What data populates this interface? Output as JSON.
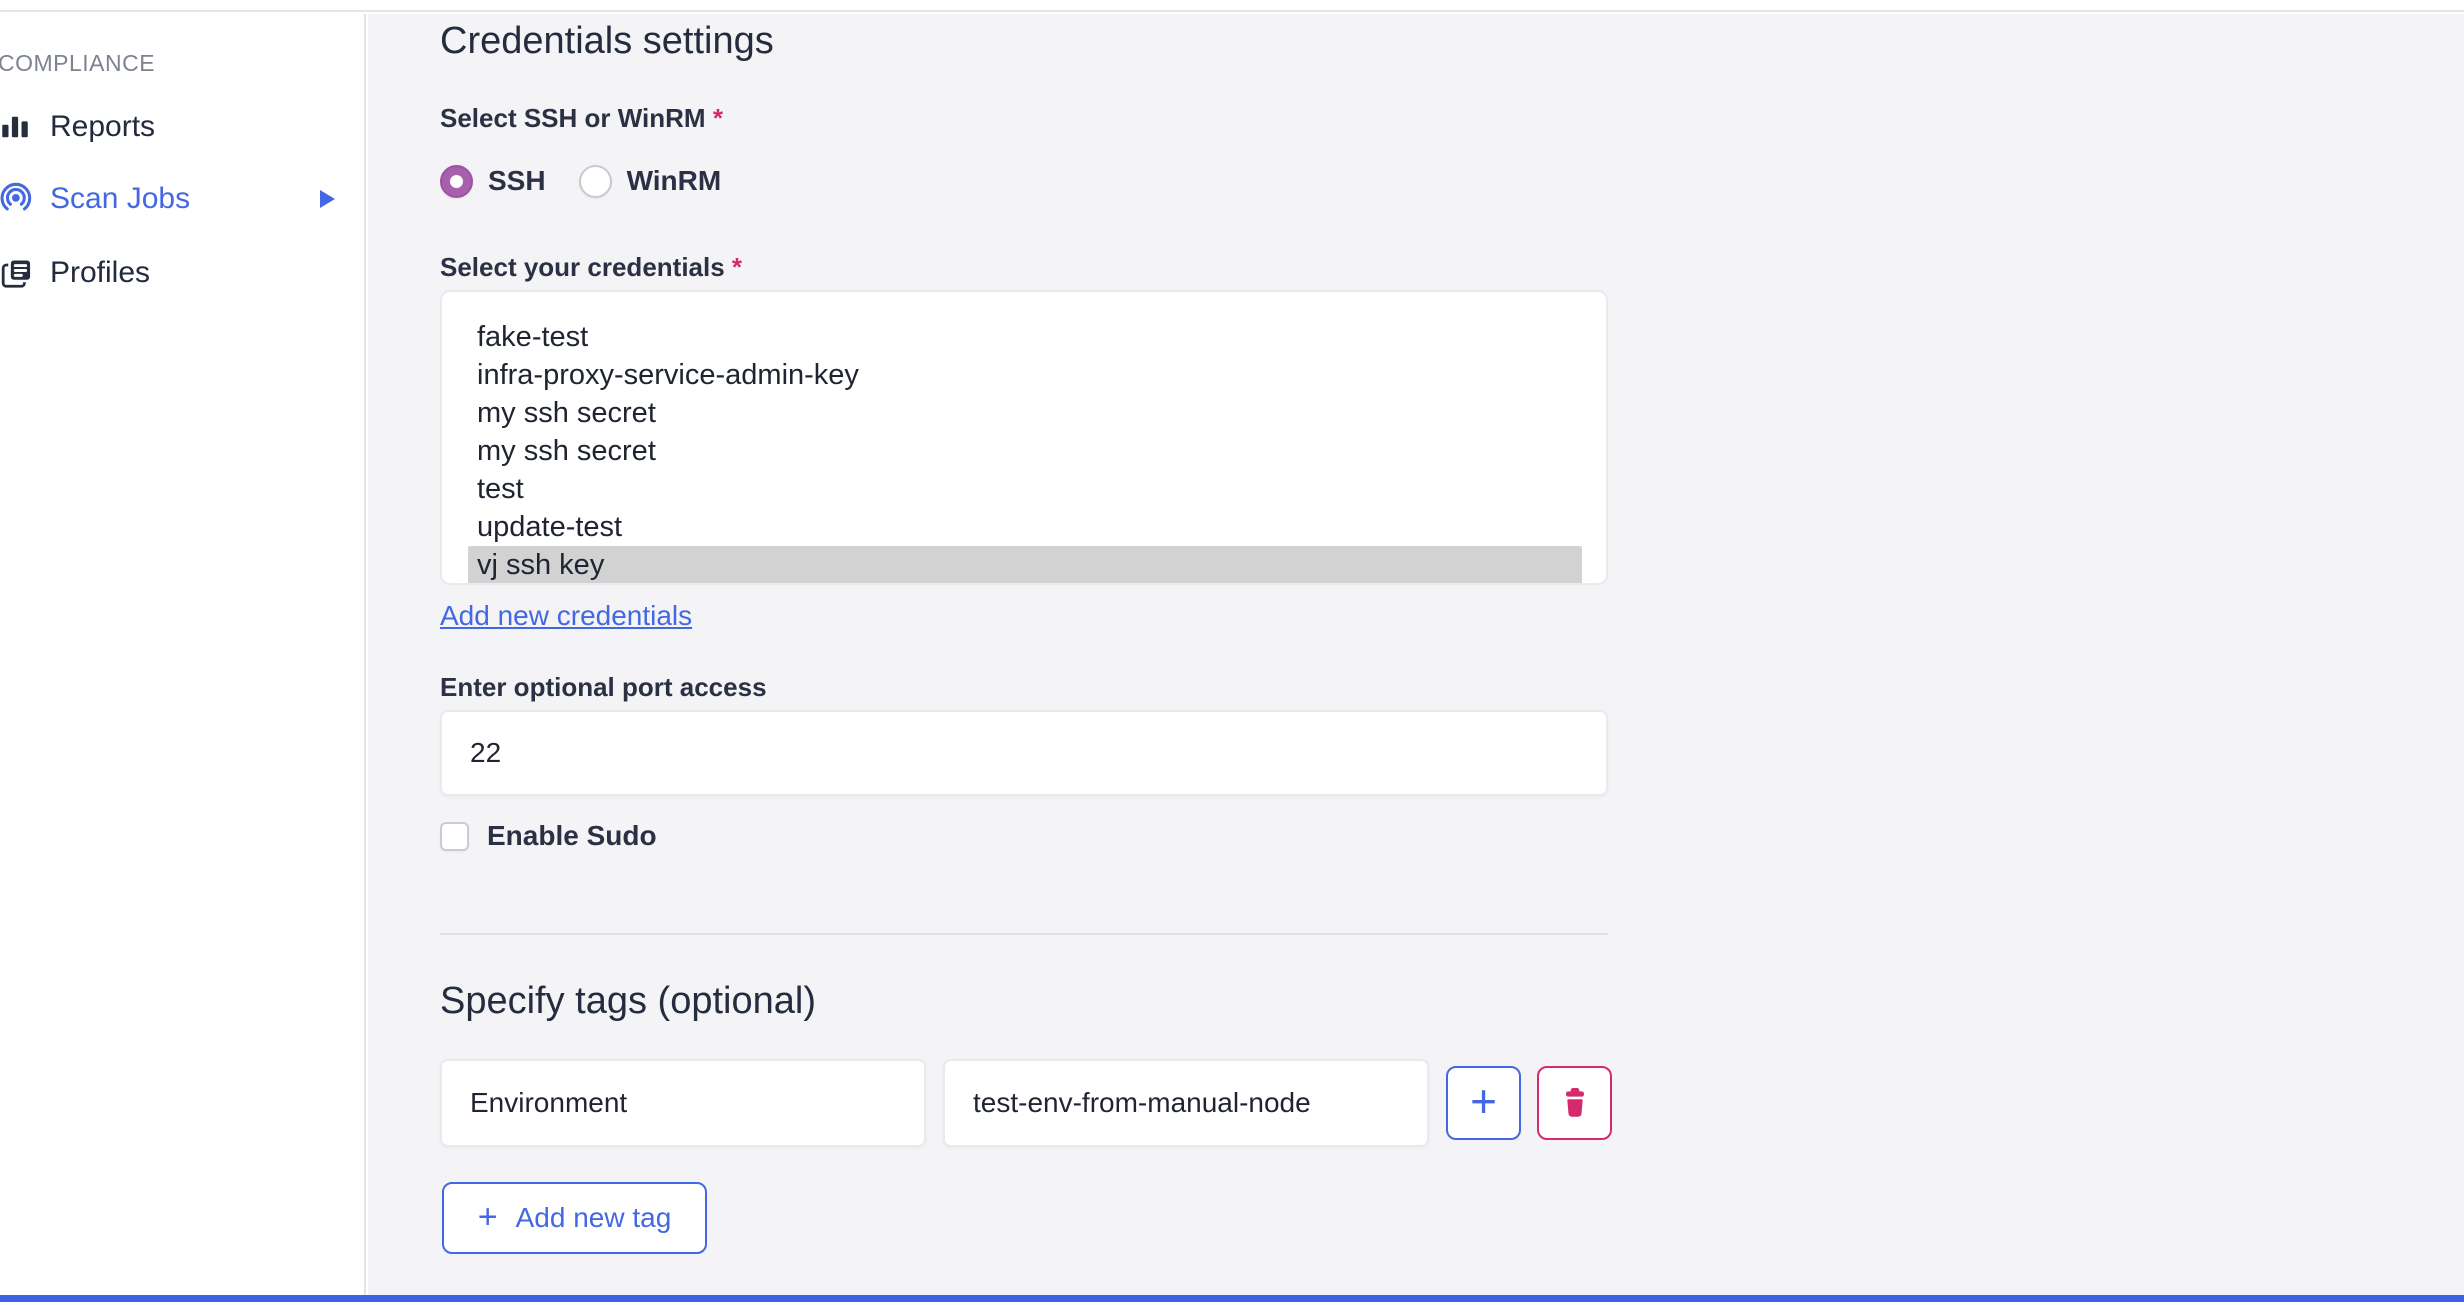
{
  "sidebar": {
    "section_label": "COMPLIANCE",
    "items": [
      {
        "label": "Reports",
        "icon": "bar-chart-icon",
        "active": false
      },
      {
        "label": "Scan Jobs",
        "icon": "broadcast-icon",
        "active": true,
        "has_submenu_arrow": true
      },
      {
        "label": "Profiles",
        "icon": "documents-icon",
        "active": false
      }
    ]
  },
  "main": {
    "title": "Credentials settings",
    "protocol": {
      "label": "Select SSH or WinRM",
      "required_marker": "*",
      "options": [
        {
          "label": "SSH",
          "selected": true
        },
        {
          "label": "WinRM",
          "selected": false
        }
      ]
    },
    "credentials": {
      "label": "Select your credentials",
      "required_marker": "*",
      "options": [
        "fake-test",
        "infra-proxy-service-admin-key",
        "my ssh secret",
        "my ssh secret",
        "test",
        "update-test",
        "vj ssh key"
      ],
      "selected_option": "vj ssh key",
      "selected_index": 6,
      "add_link_label": "Add new credentials"
    },
    "port": {
      "label": "Enter optional port access",
      "value": "22"
    },
    "sudo": {
      "label": "Enable Sudo",
      "checked": false
    },
    "tags": {
      "title": "Specify tags (optional)",
      "rows": [
        {
          "key": "Environment",
          "value": "test-env-from-manual-node"
        }
      ],
      "plus_symbol": "+",
      "add_button_label": "Add new tag"
    }
  },
  "colors": {
    "accent_blue": "#4468e1",
    "bottom_bar_blue": "#3c63e6",
    "radio_selected_purple": "#a75fae",
    "required_asterisk_pink": "#d5296e",
    "delete_pink": "#d62a6e",
    "selected_option_bg": "#d2d2d3",
    "main_background": "#f4f4f6",
    "dark_text": "#262c3f",
    "muted_gray": "#7c848e"
  }
}
